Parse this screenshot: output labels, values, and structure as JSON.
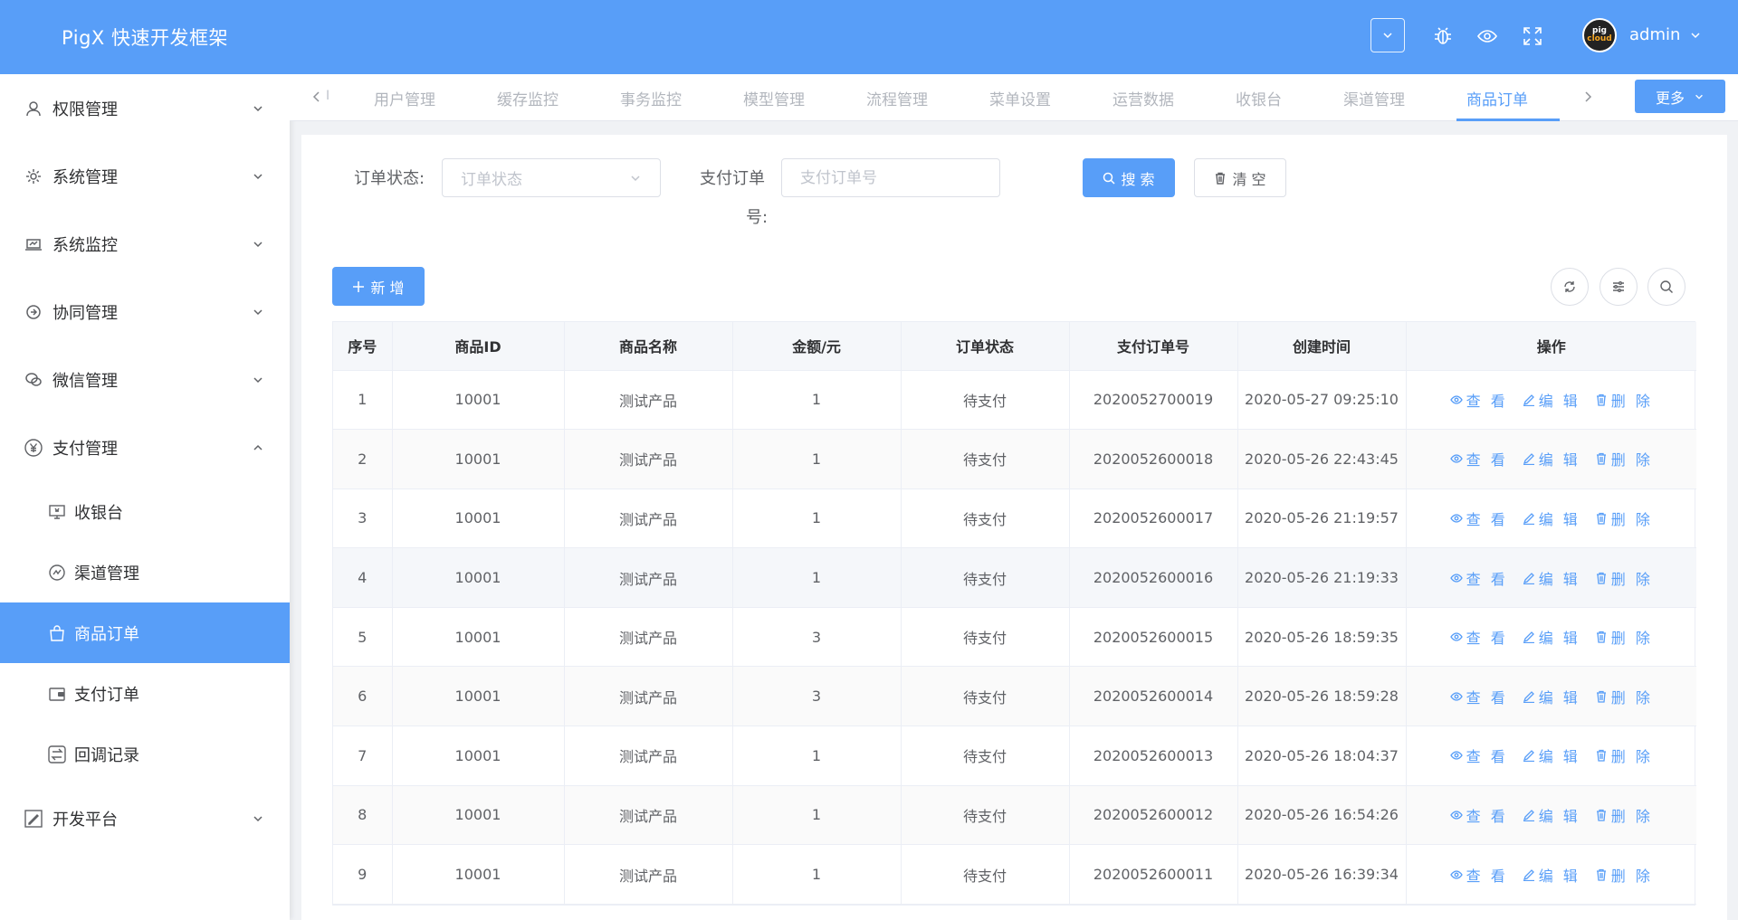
{
  "app": {
    "title": "PigX 快速开发框架"
  },
  "sidebar": {
    "items": [
      {
        "label": "权限管理",
        "icon": "user-icon"
      },
      {
        "label": "系统管理",
        "icon": "gear-icon"
      },
      {
        "label": "系统监控",
        "icon": "monitor-icon"
      },
      {
        "label": "协同管理",
        "icon": "workflow-icon"
      },
      {
        "label": "微信管理",
        "icon": "wechat-icon"
      },
      {
        "label": "支付管理",
        "icon": "yen-icon",
        "expanded": true,
        "children": [
          {
            "label": "收银台",
            "icon": "cashier-icon"
          },
          {
            "label": "渠道管理",
            "icon": "channel-icon"
          },
          {
            "label": "商品订单",
            "icon": "bag-icon",
            "active": true
          },
          {
            "label": "支付订单",
            "icon": "wallet-icon"
          },
          {
            "label": "回调记录",
            "icon": "callback-icon"
          }
        ]
      },
      {
        "label": "开发平台",
        "icon": "edit-icon"
      }
    ]
  },
  "header": {
    "username": "admin",
    "avatar_top": "pig",
    "avatar_bottom": "cloud"
  },
  "tags": {
    "items": [
      "用户管理",
      "缓存监控",
      "事务监控",
      "模型管理",
      "流程管理",
      "菜单设置",
      "运营数据",
      "收银台",
      "渠道管理",
      "商品订单"
    ],
    "active_index": 9,
    "more_label": "更多"
  },
  "search_form": {
    "status_label": "订单状态:",
    "status_placeholder": "订单状态",
    "pay_order_label_line1": "支付订单",
    "pay_order_label_line2": "号:",
    "pay_order_placeholder": "支付订单号",
    "search_button": "搜 索",
    "clear_button": "清 空"
  },
  "toolbar": {
    "add_button": "新 增"
  },
  "table": {
    "columns": [
      "序号",
      "商品ID",
      "商品名称",
      "金额/元",
      "订单状态",
      "支付订单号",
      "创建时间",
      "操作"
    ],
    "actions": {
      "view": "查 看",
      "edit": "编 辑",
      "delete": "删 除"
    },
    "rows": [
      [
        "1",
        "10001",
        "测试产品",
        "1",
        "待支付",
        "2020052700019",
        "2020-05-27 09:25:10"
      ],
      [
        "2",
        "10001",
        "测试产品",
        "1",
        "待支付",
        "2020052600018",
        "2020-05-26 22:43:45"
      ],
      [
        "3",
        "10001",
        "测试产品",
        "1",
        "待支付",
        "2020052600017",
        "2020-05-26 21:19:57"
      ],
      [
        "4",
        "10001",
        "测试产品",
        "1",
        "待支付",
        "2020052600016",
        "2020-05-26 21:19:33"
      ],
      [
        "5",
        "10001",
        "测试产品",
        "3",
        "待支付",
        "2020052600015",
        "2020-05-26 18:59:35"
      ],
      [
        "6",
        "10001",
        "测试产品",
        "3",
        "待支付",
        "2020052600014",
        "2020-05-26 18:59:28"
      ],
      [
        "7",
        "10001",
        "测试产品",
        "1",
        "待支付",
        "2020052600013",
        "2020-05-26 18:04:37"
      ],
      [
        "8",
        "10001",
        "测试产品",
        "1",
        "待支付",
        "2020052600012",
        "2020-05-26 16:54:26"
      ],
      [
        "9",
        "10001",
        "测试产品",
        "1",
        "待支付",
        "2020052600011",
        "2020-05-26 16:39:34"
      ]
    ]
  },
  "colors": {
    "primary": "#589ef8",
    "text": "#606266",
    "border": "#dcdfe6"
  }
}
